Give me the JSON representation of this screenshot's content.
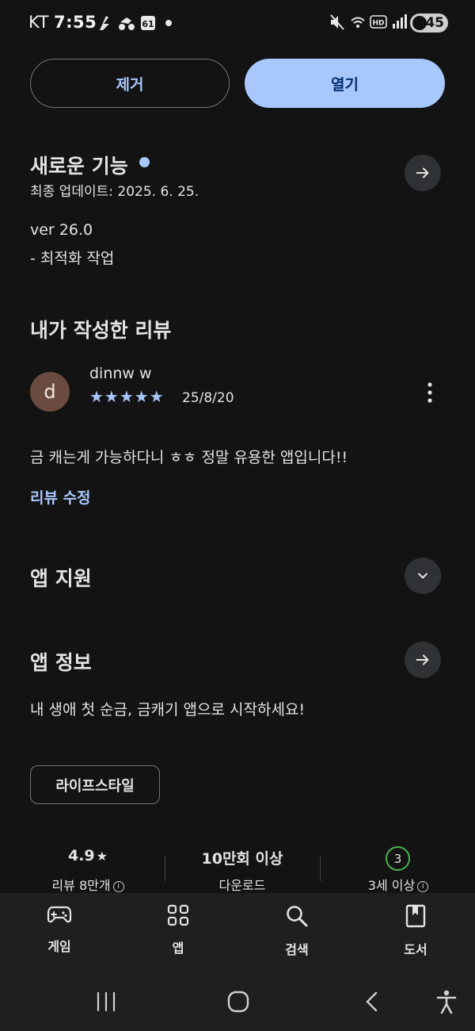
{
  "status_bar": {
    "carrier": "KT",
    "time": "7:55",
    "battery": "45"
  },
  "actions": {
    "remove_label": "제거",
    "open_label": "열기"
  },
  "whats_new": {
    "title": "새로운 기능",
    "last_updated": "최종 업데이트: 2025. 6. 25.",
    "version": "ver 26.0",
    "notes": "- 최적화 작업"
  },
  "my_review": {
    "title": "내가 작성한 리뷰",
    "avatar_letter": "d",
    "reviewer": "dinnw w",
    "rating_stars": 5,
    "stars_text": "★★★★★",
    "date": "25/8/20",
    "text": "금 캐는게 가능하다니 ㅎㅎ 정말 유용한 앱입니다!!",
    "edit_label": "리뷰 수정"
  },
  "app_support": {
    "title": "앱 지원"
  },
  "app_info": {
    "title": "앱 정보",
    "description": "내 생애 첫 순금, 금캐기 앱으로 시작하세요!",
    "category_chip": "라이프스타일"
  },
  "stats": {
    "rating_value": "4.9",
    "rating_label": "리뷰 8만개",
    "downloads_value": "10만회 이상",
    "downloads_label": "다운로드",
    "age_value": "3",
    "age_label": "3세 이상"
  },
  "bottom_nav": {
    "items": [
      {
        "label": "게임",
        "icon": "gamepad-icon"
      },
      {
        "label": "앱",
        "icon": "apps-grid-icon"
      },
      {
        "label": "검색",
        "icon": "search-icon"
      },
      {
        "label": "도서",
        "icon": "book-icon"
      }
    ]
  },
  "colors": {
    "background": "#131314",
    "accent": "#a8c7fa",
    "on_accent": "#062e6f",
    "age_badge": "#4caf50"
  }
}
